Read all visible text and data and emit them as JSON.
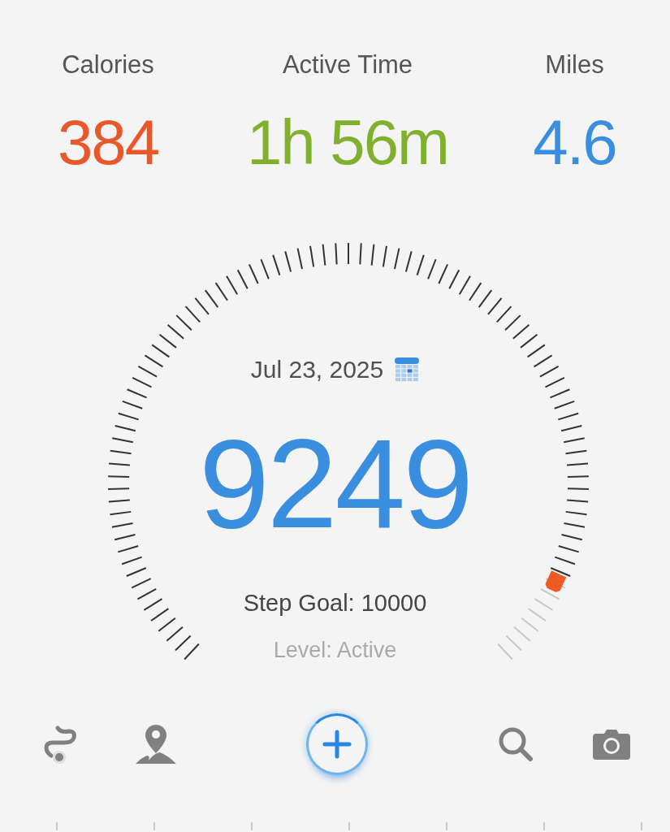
{
  "stats": [
    {
      "label": "Calories",
      "value": "384",
      "color": "#e8582a"
    },
    {
      "label": "Active Time",
      "value": "1h 56m",
      "color": "#80b02e"
    },
    {
      "label": "Miles",
      "value": "4.6",
      "color": "#3a8ee0"
    }
  ],
  "gauge": {
    "date": "Jul 23, 2025",
    "steps": "9249",
    "goal": "Step Goal: 10000",
    "activity": "Level: Active"
  }
}
